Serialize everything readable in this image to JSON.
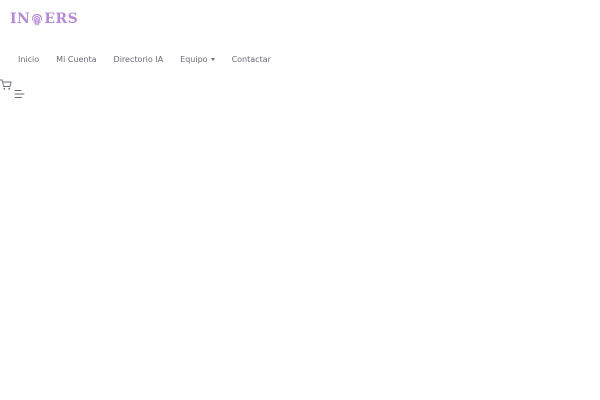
{
  "brand": {
    "logo_prefix": "IN",
    "logo_suffix": "ERS",
    "logo_color": "#b58ad6",
    "logo_icon": "fingerprint-icon"
  },
  "nav": {
    "items": [
      {
        "label": "Inicio"
      },
      {
        "label": "Mi Cuenta"
      },
      {
        "label": "Directorio IA"
      },
      {
        "label": "Equipo",
        "has_dropdown": true
      },
      {
        "label": "Contactar"
      }
    ],
    "text_color": "#6b6b78"
  },
  "header_icons": {
    "cart_icon": "shopping-cart-icon",
    "menu_icon": "hamburger-menu-icon"
  }
}
